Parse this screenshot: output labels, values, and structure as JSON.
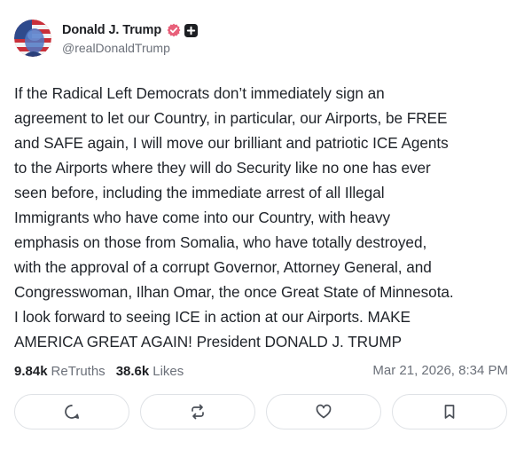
{
  "author": {
    "display_name": "Donald J. Trump",
    "handle": "@realDonaldTrump",
    "avatar_icon": "flag-portrait-avatar",
    "verified_icon": "verified-badge-icon",
    "verified_color": "#e8607a",
    "plus_icon": "plus-badge-icon"
  },
  "post": {
    "lines": [
      "If the Radical Left Democrats don’t immediately sign an",
      "agreement to let our Country, in particular, our Airports, be FREE",
      "and SAFE again, I will move our brilliant and patriotic ICE Agents",
      "to the Airports where they will do Security like no one has ever",
      "seen before, including the immediate arrest of all Illegal",
      "Immigrants who have come into our Country, with heavy",
      "emphasis on those from Somalia, who have totally destroyed,",
      "with the approval of a corrupt Governor, Attorney General, and",
      "Congresswoman, Ilhan Omar, the once Great State of Minnesota.",
      "I look forward to seeing ICE in action at our Airports. MAKE",
      "AMERICA GREAT AGAIN! President DONALD J. TRUMP"
    ],
    "retruths_count": "9.84k",
    "retruths_label": "ReTruths",
    "likes_count": "38.6k",
    "likes_label": "Likes",
    "timestamp": "Mar 21, 2026, 8:34 PM"
  },
  "actions": [
    {
      "name": "reply",
      "icon": "comment-icon"
    },
    {
      "name": "retruth",
      "icon": "repost-icon"
    },
    {
      "name": "like",
      "icon": "heart-icon"
    },
    {
      "name": "bookmark",
      "icon": "bookmark-icon"
    }
  ],
  "colors": {
    "text_primary": "#1f2329",
    "text_secondary": "#6b7079",
    "button_border": "#dfe2e6",
    "icon_stroke": "#4a4f57"
  }
}
